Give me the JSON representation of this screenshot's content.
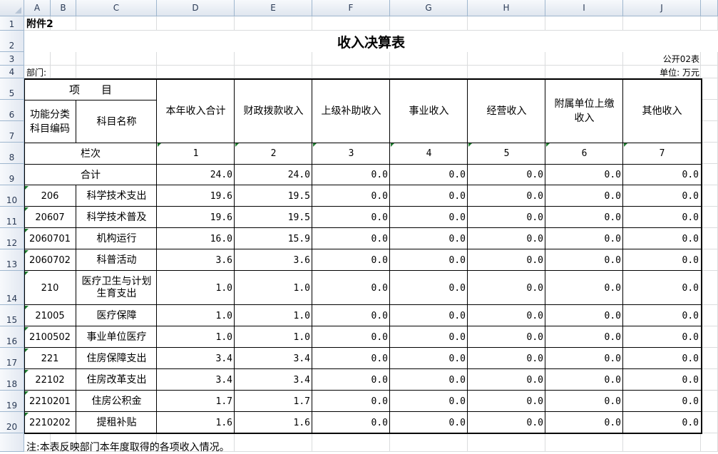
{
  "sheet": {
    "columns": [
      "A",
      "B",
      "C",
      "D",
      "E",
      "F",
      "G",
      "H",
      "I",
      "J"
    ],
    "rows": [
      "1",
      "2",
      "3",
      "4",
      "5",
      "6",
      "7",
      "8",
      "9",
      "10",
      "11",
      "12",
      "13",
      "14",
      "15",
      "16",
      "17",
      "18",
      "19",
      "20"
    ]
  },
  "doc": {
    "attachment": "附件2",
    "title": "收入决算表",
    "table_no": "公开02表",
    "dept_label": "部门:",
    "unit": "单位: 万元",
    "note": "注:本表反映部门本年度取得的各项收入情况。"
  },
  "headers": {
    "item": "项　　目",
    "code": "功能分类科目编码",
    "name": "科目名称",
    "total": "本年收入合计",
    "fiscal": "财政拨款收入",
    "superior": "上级补助收入",
    "business": "事业收入",
    "operating": "经营收入",
    "affiliated": "附属单位上缴收入",
    "other": "其他收入",
    "col_index": "栏次",
    "idx": [
      "1",
      "2",
      "3",
      "4",
      "5",
      "6",
      "7"
    ]
  },
  "rows": [
    {
      "code": "",
      "name": "合计",
      "vals": [
        "24.0",
        "24.0",
        "0.0",
        "0.0",
        "0.0",
        "0.0",
        "0.0"
      ]
    },
    {
      "code": "206",
      "name": "科学技术支出",
      "vals": [
        "19.6",
        "19.5",
        "0.0",
        "0.0",
        "0.0",
        "0.0",
        "0.0"
      ]
    },
    {
      "code": "20607",
      "name": "科学技术普及",
      "vals": [
        "19.6",
        "19.5",
        "0.0",
        "0.0",
        "0.0",
        "0.0",
        "0.0"
      ]
    },
    {
      "code": "2060701",
      "name": "机构运行",
      "vals": [
        "16.0",
        "15.9",
        "0.0",
        "0.0",
        "0.0",
        "0.0",
        "0.0"
      ]
    },
    {
      "code": "2060702",
      "name": "科普活动",
      "vals": [
        "3.6",
        "3.6",
        "0.0",
        "0.0",
        "0.0",
        "0.0",
        "0.0"
      ]
    },
    {
      "code": "210",
      "name": "医疗卫生与计划生育支出",
      "vals": [
        "1.0",
        "1.0",
        "0.0",
        "0.0",
        "0.0",
        "0.0",
        "0.0"
      ]
    },
    {
      "code": "21005",
      "name": "医疗保障",
      "vals": [
        "1.0",
        "1.0",
        "0.0",
        "0.0",
        "0.0",
        "0.0",
        "0.0"
      ]
    },
    {
      "code": "2100502",
      "name": "事业单位医疗",
      "vals": [
        "1.0",
        "1.0",
        "0.0",
        "0.0",
        "0.0",
        "0.0",
        "0.0"
      ]
    },
    {
      "code": "221",
      "name": "住房保障支出",
      "vals": [
        "3.4",
        "3.4",
        "0.0",
        "0.0",
        "0.0",
        "0.0",
        "0.0"
      ]
    },
    {
      "code": "22102",
      "name": "住房改革支出",
      "vals": [
        "3.4",
        "3.4",
        "0.0",
        "0.0",
        "0.0",
        "0.0",
        "0.0"
      ]
    },
    {
      "code": "2210201",
      "name": "住房公积金",
      "vals": [
        "1.7",
        "1.7",
        "0.0",
        "0.0",
        "0.0",
        "0.0",
        "0.0"
      ]
    },
    {
      "code": "2210202",
      "name": "提租补贴",
      "vals": [
        "1.6",
        "1.6",
        "0.0",
        "0.0",
        "0.0",
        "0.0",
        "0.0"
      ]
    }
  ]
}
